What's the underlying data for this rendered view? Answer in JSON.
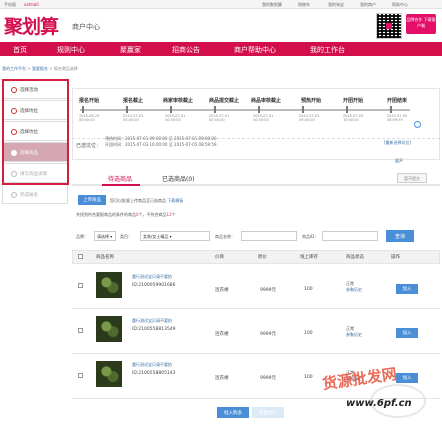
{
  "topbar": {
    "left_1": "手机版",
    "left_2": "xstmall",
    "right_items": [
      "我的聚划算",
      "购物车",
      "我的淘宝",
      "我的商户",
      "帮助中心"
    ]
  },
  "header": {
    "logo": "聚划算",
    "subtitle": "商户中心",
    "promo_text": "品牌合作 下载客户端"
  },
  "nav": {
    "items": [
      "首页",
      "规则中心",
      "聚赢家",
      "招商公告",
      "商户帮助中心",
      "我的工作台"
    ]
  },
  "breadcrumb": {
    "part1": "我的工作平台",
    "sep": " > ",
    "part2": "我要报名",
    "part3": "报名商品选择"
  },
  "sidebar": {
    "items": [
      {
        "label": "选择活动",
        "state": "done"
      },
      {
        "label": "选择坑位",
        "state": "done"
      },
      {
        "label": "选择坑位",
        "state": "done"
      },
      {
        "label": "选择商品",
        "state": "active"
      },
      {
        "label": "填写商品详情",
        "state": "todo"
      },
      {
        "label": "完成报名",
        "state": "todo"
      }
    ]
  },
  "timeline": {
    "steps": [
      {
        "label": "报名开始",
        "date": "2015-06-29\n00:00:00"
      },
      {
        "label": "报名截止",
        "date": "2015-07-01\n00:00:00"
      },
      {
        "label": "商家审核截止",
        "date": "2015-07-01\n00:00:00"
      },
      {
        "label": "商品提交截止",
        "date": "2015-07-01\n00:00:00"
      },
      {
        "label": "商品审核截止",
        "date": "2015-07-01\n00:00:00"
      },
      {
        "label": "预热开始",
        "date": "2015-07-01\n09:00:00"
      },
      {
        "label": "开团开始",
        "date": "2015-07-03\n10:00:00"
      },
      {
        "label": "开团结束",
        "date": "2015-07-05\n08:59:59"
      }
    ],
    "selected_label": "已选坑位：",
    "selected_line1": "预热时间：2015-07-01 09:00:00 至 2015-07-01 09:00:00",
    "selected_line2": "开团时间：2015-07-03 10:00:00 至 2015-07-05 08:59:59",
    "reselect_link": "[重新选择坑位]",
    "expand_link": "展开"
  },
  "tabs": {
    "pending": "待选商品",
    "selected": "已选商品(0)",
    "no_submit": "暂不提交"
  },
  "upload": {
    "button": "上传商品",
    "hint": "您可以批量上传商品至已选商品",
    "hint_link": "下载模板",
    "count_text_a": "共找到符合要报商品的条件的商品",
    "count_value": "0",
    "count_text_b": "个，不符合商品",
    "count_value2": "12",
    "count_text_c": "个"
  },
  "filters": {
    "brand_label": "品牌：",
    "brand_value": "请选择",
    "category_label": "类目：",
    "category_value": "女装/女士精品",
    "name_label": "商品名称：",
    "id_label": "商品ID：",
    "search_button": "查询"
  },
  "table": {
    "headers": [
      "商品名称",
      "价目",
      "原价",
      "线上库存",
      "商品状态",
      "操作"
    ],
    "rows": [
      {
        "name": "重行测试宝贝请不要拍",
        "id": "ID:2100059901686",
        "price": "连衣裙",
        "orig": "9999元",
        "stock": "100",
        "status": "正常",
        "status_link": "参聚历史",
        "action": "加入"
      },
      {
        "name": "重行测试宝贝请不要拍",
        "id": "ID:2100558813549",
        "price": "连衣裙",
        "orig": "9999元",
        "stock": "100",
        "status": "正常",
        "status_link": "参聚历史",
        "action": "加入"
      },
      {
        "name": "重行测试宝贝请不要拍",
        "id": "ID:2100558805143",
        "price": "连衣裙",
        "orig": "9999元",
        "stock": "100",
        "status": "正常",
        "status_link": "参聚历史",
        "action": "加入"
      }
    ]
  },
  "bulk": {
    "add": "批入购多",
    "remove": "批量加入"
  },
  "watermark": {
    "cn": "货源批发网",
    "url": "www.6pf.cn"
  },
  "colors": {
    "brand": "#d20f4b",
    "button_blue": "#4b8ed8",
    "link_blue": "#3a6ea5"
  }
}
